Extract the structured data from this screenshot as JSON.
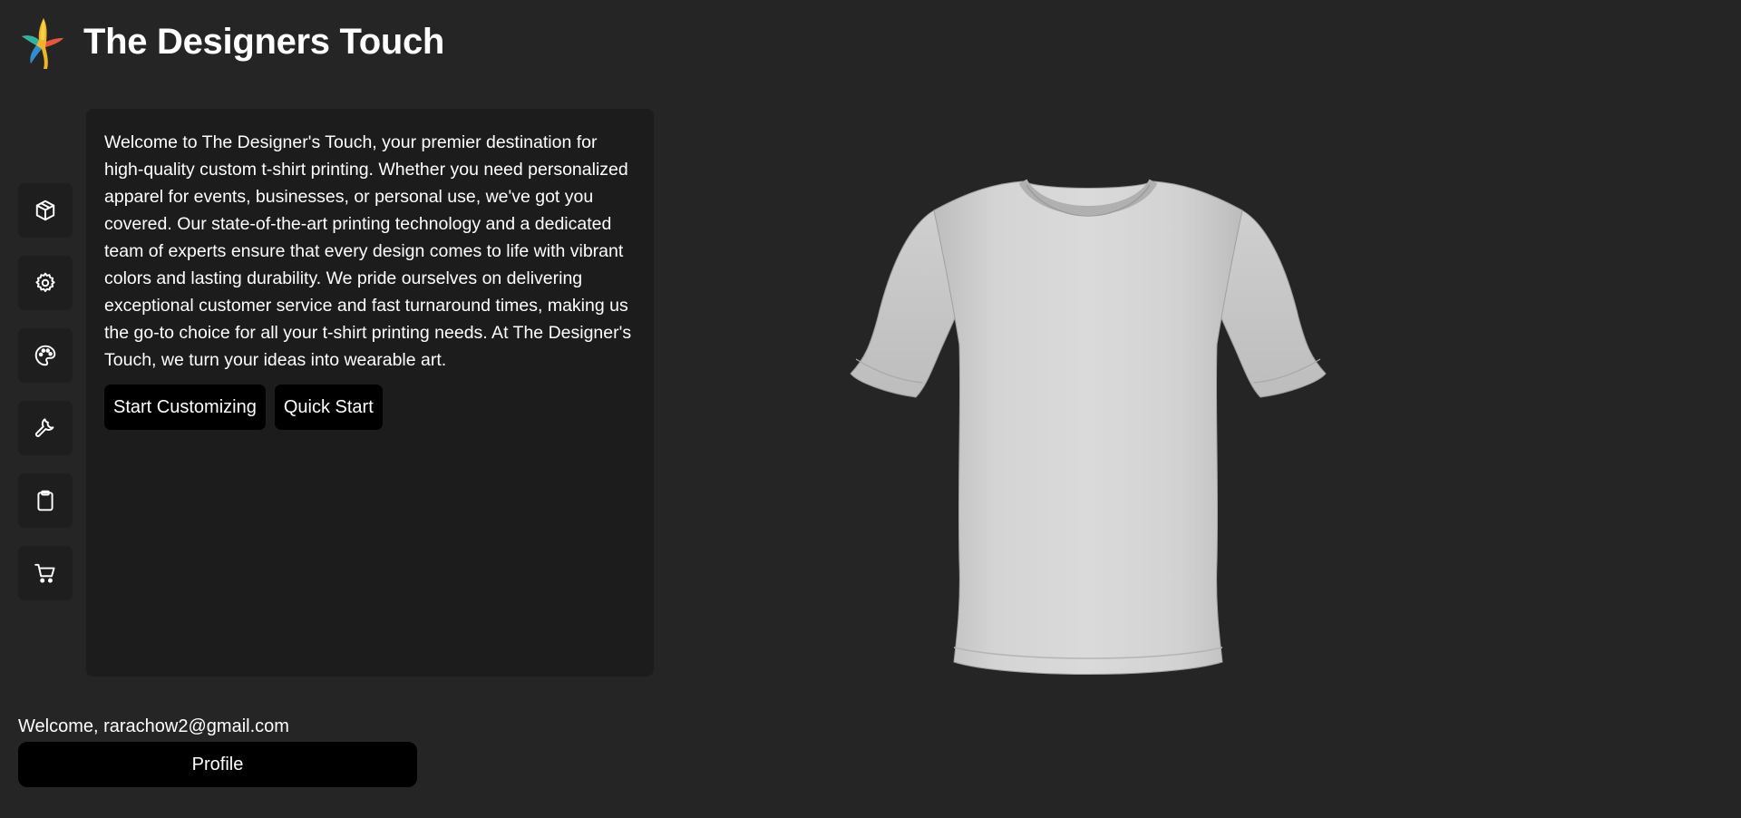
{
  "header": {
    "title": "The Designers Touch",
    "logo_icon": "bird-logo-icon"
  },
  "sidebar": {
    "items": [
      {
        "icon": "box-icon"
      },
      {
        "icon": "gear-icon"
      },
      {
        "icon": "palette-icon"
      },
      {
        "icon": "wrench-icon"
      },
      {
        "icon": "clipboard-icon"
      },
      {
        "icon": "cart-icon"
      }
    ]
  },
  "panel": {
    "intro": "Welcome to The Designer's Touch, your premier destination for high-quality custom t-shirt printing. Whether you need personalized apparel for events, businesses, or personal use, we've got you covered. Our state-of-the-art printing technology and a dedicated team of experts ensure that every design comes to life with vibrant colors and lasting durability. We pride ourselves on delivering exceptional customer service and fast turnaround times, making us the go-to choice for all your t-shirt printing needs. At The Designer's Touch, we turn your ideas into wearable art.",
    "start_customizing_label": "Start Customizing",
    "quick_start_label": "Quick Start"
  },
  "user": {
    "welcome_text": "Welcome, rarachow2@gmail.com",
    "profile_label": "Profile"
  },
  "colors": {
    "background": "#252525",
    "panel": "#1c1c1c",
    "button": "#000000",
    "shirt": "#d6d6d6"
  }
}
